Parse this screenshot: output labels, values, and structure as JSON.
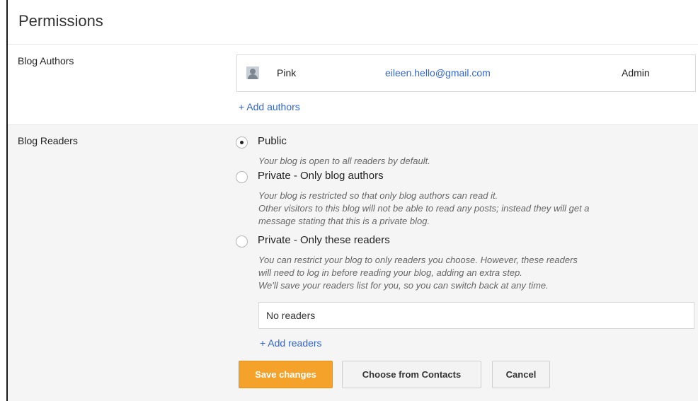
{
  "page": {
    "title": "Permissions"
  },
  "authors": {
    "label": "Blog Authors",
    "list": [
      {
        "name": "Pink",
        "email": "eileen.hello@gmail.com",
        "role": "Admin",
        "avatar_icon": "user-avatar-icon"
      }
    ],
    "add_link": "+ Add authors"
  },
  "readers": {
    "label": "Blog Readers",
    "options": [
      {
        "label": "Public",
        "checked": true,
        "desc": [
          "Your blog is open to all readers by default."
        ]
      },
      {
        "label": "Private - Only blog authors",
        "checked": false,
        "desc": [
          "Your blog is restricted so that only blog authors can read it.",
          "Other visitors to this blog will not be able to read any posts; instead they will get a",
          "message stating that this is a private blog."
        ]
      },
      {
        "label": "Private - Only these readers",
        "checked": false,
        "desc": [
          "You can restrict your blog to only readers you choose. However, these readers",
          "will need to log in before reading your blog, adding an extra step.",
          "We'll save your readers list for you, so you can switch back at any time."
        ]
      }
    ],
    "readers_field_value": "No readers",
    "add_link": "+ Add readers"
  },
  "actions": {
    "save": "Save changes",
    "choose_contacts": "Choose from Contacts",
    "cancel": "Cancel"
  },
  "colors": {
    "accent": "#f5a22a",
    "link": "#3366cc",
    "section_bg": "#f5f5f5"
  }
}
